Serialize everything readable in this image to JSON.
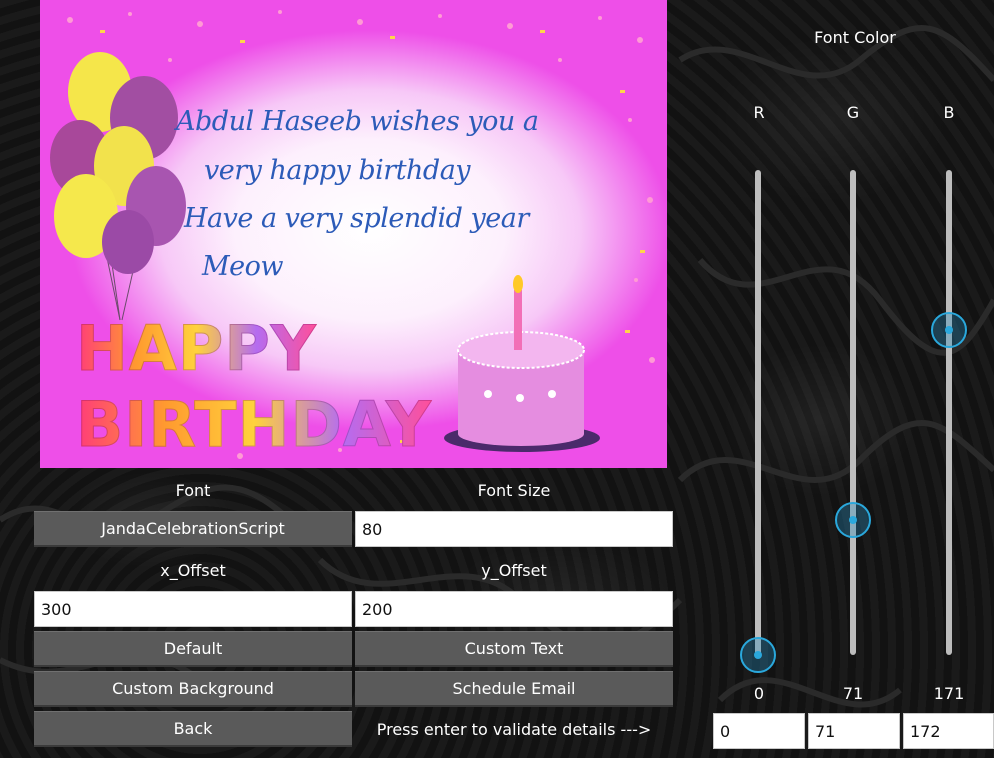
{
  "card": {
    "lines": [
      "Abdul Haseeb wishes you a",
      "very happy birthday",
      "Have a very splendid year",
      "Meow"
    ],
    "happy": "HAPPY",
    "birthday": "BIRTHDAY"
  },
  "form": {
    "font_label": "Font",
    "font_button": "JandaCelebrationScript",
    "font_size_label": "Font Size",
    "font_size_value": "80",
    "x_offset_label": "x_Offset",
    "x_offset_value": "300",
    "y_offset_label": "y_Offset",
    "y_offset_value": "200",
    "default_button": "Default",
    "custom_text_button": "Custom Text",
    "custom_background_button": "Custom Background",
    "schedule_email_button": "Schedule Email",
    "back_button": "Back",
    "hint": "Press enter to validate details --->"
  },
  "color": {
    "title": "Font Color",
    "r_label": "R",
    "g_label": "G",
    "b_label": "B",
    "r_value": "0",
    "g_value": "71",
    "b_value": "171",
    "r_input": "0",
    "g_input": "71",
    "b_input": "172",
    "slider_max": 255,
    "accent": "#2aa8dc"
  }
}
